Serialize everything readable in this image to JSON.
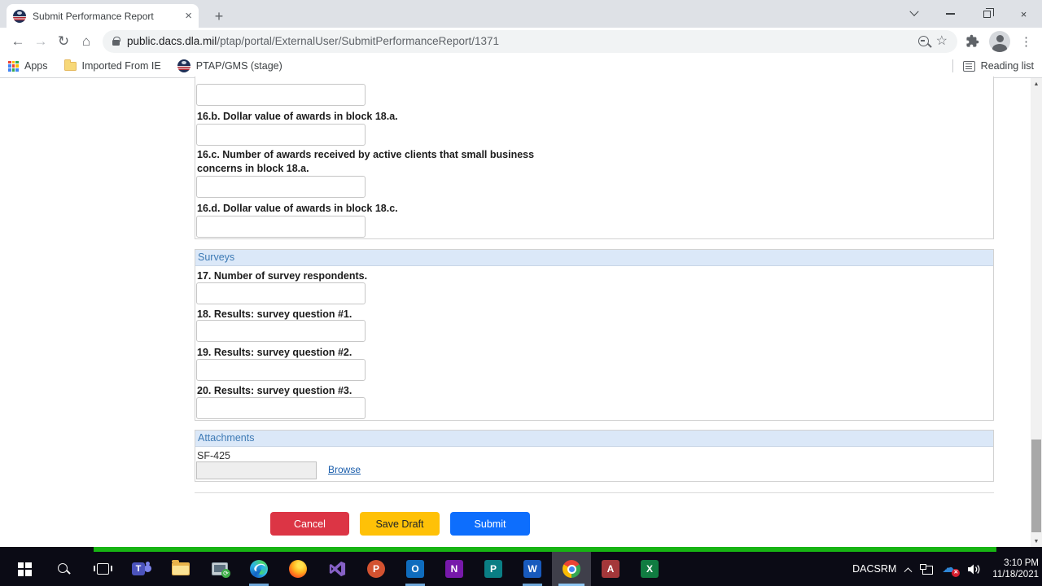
{
  "browser": {
    "tab": {
      "title": "Submit Performance Report"
    },
    "address": {
      "domain": "public.dacs.dla.mil",
      "path": "/ptap/portal/ExternalUser/SubmitPerformanceReport/1371"
    },
    "bookmarks_bar": {
      "apps_label": "Apps",
      "imported_label": "Imported From IE",
      "ptap_label": "PTAP/GMS (stage)",
      "reading_list_label": "Reading list"
    },
    "new_tab_glyph": "+",
    "tab_close_glyph": "×",
    "window_close_glyph": "×",
    "back_glyph": "←",
    "forward_glyph": "→",
    "reload_glyph": "↻",
    "home_glyph": "⌂",
    "star_glyph": "☆",
    "menu_glyph": "⋮"
  },
  "form": {
    "awards": {
      "field_b_label": "16.b. Dollar value of awards in block 18.a.",
      "field_c_label": "16.c. Number of awards received by active clients that small business concerns in block 18.a.",
      "field_d_label": "16.d. Dollar value of awards in block 18.c."
    },
    "surveys": {
      "header": "Surveys",
      "fields": [
        "17. Number of survey respondents.",
        "18. Results: survey question #1.",
        "19. Results: survey question #2.",
        "20. Results: survey question #3."
      ]
    },
    "attachments": {
      "header": "Attachments",
      "file_label": "SF-425",
      "browse_label": "Browse"
    },
    "actions": {
      "cancel": "Cancel",
      "save_draft": "Save Draft",
      "submit": "Submit"
    }
  },
  "scrollbar": {
    "up_glyph": "▲",
    "down_glyph": "▼"
  },
  "taskbar": {
    "tray_label": "DACSRM",
    "clock": {
      "time": "3:10 PM",
      "date": "11/18/2021"
    },
    "tiles": {
      "powerpoint": "P",
      "outlook": "O",
      "onenote": "N",
      "publisher": "P",
      "word": "W",
      "access": "A",
      "excel": "X",
      "teams": "T"
    }
  },
  "colors": {
    "cancel_red": "#dc3545",
    "save_draft_yellow": "#ffc107",
    "submit_blue": "#0d6efd",
    "section_header_bg": "#dbe8f8",
    "section_header_text": "#3d7ab5",
    "share_border_green": "#17b413"
  }
}
